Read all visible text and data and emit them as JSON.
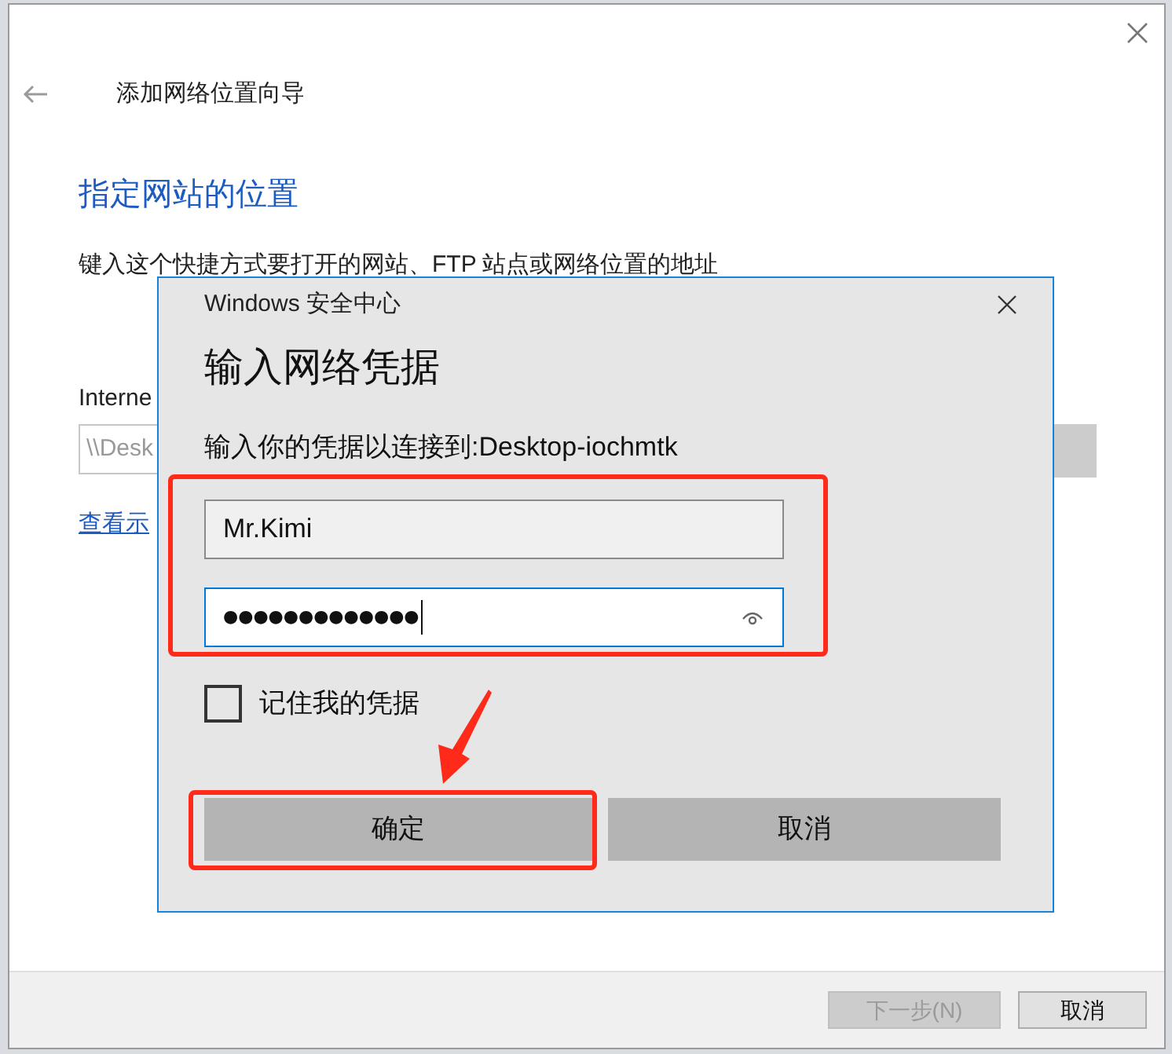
{
  "wizard": {
    "title": "添加网络位置向导",
    "heading": "指定网站的位置",
    "description": "键入这个快捷方式要打开的网站、FTP 站点或网络位置的地址",
    "address_label": "Interne",
    "address_value": "\\\\Desk",
    "example_link": "查看示",
    "buttons": [
      {
        "label": "下一步(N)",
        "disabled": true
      },
      {
        "label": "取消",
        "disabled": false
      }
    ]
  },
  "dialog": {
    "app_title": "Windows 安全中心",
    "heading": "输入网络凭据",
    "prompt": "输入你的凭据以连接到:Desktop-iochmtk",
    "fields_highlighted": true,
    "username": {
      "value": "Mr.Kimi",
      "focused": false
    },
    "password": {
      "masked_value": "●●●●●●●●●●●●●",
      "focused": true
    },
    "remember": {
      "label": "记住我的凭据",
      "checked": false
    },
    "buttons": [
      {
        "label": "确定",
        "highlighted": true
      },
      {
        "label": "取消",
        "highlighted": false
      }
    ]
  }
}
